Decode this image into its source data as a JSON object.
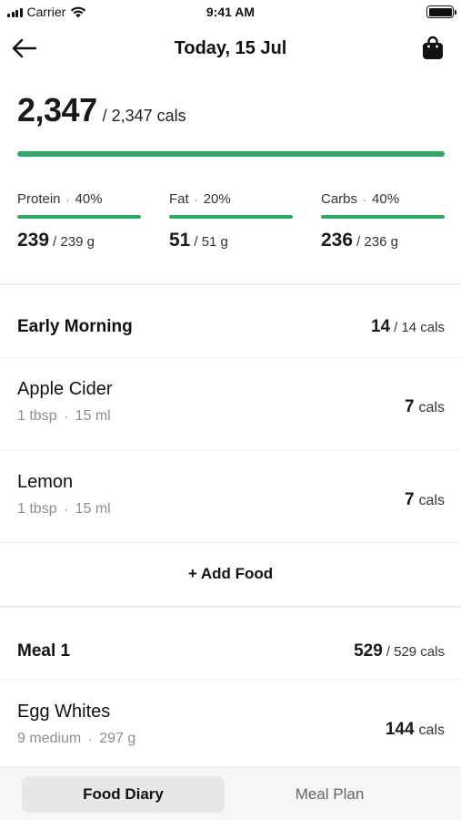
{
  "status_bar": {
    "carrier": "Carrier",
    "time": "9:41 AM"
  },
  "nav": {
    "title": "Today, 15 Jul",
    "back_icon": "arrow-left-icon",
    "right_icon": "shopping-bag-icon"
  },
  "summary": {
    "calories": "2,347",
    "calories_goal": "/ 2,347 cals",
    "progress_fraction": 1.0,
    "accent_color": "#2fa865"
  },
  "macros": [
    {
      "name": "Protein",
      "percent": "40%",
      "value": "239",
      "goal": "/ 239 g",
      "progress_fraction": 1.0
    },
    {
      "name": "Fat",
      "percent": "20%",
      "value": "51",
      "goal": "/ 51 g",
      "progress_fraction": 1.0
    },
    {
      "name": "Carbs",
      "percent": "40%",
      "value": "236",
      "goal": "/ 236 g",
      "progress_fraction": 1.0
    }
  ],
  "groups": [
    {
      "title": "Early Morning",
      "total": "14",
      "total_goal": "/ 14 cals",
      "items": [
        {
          "name": "Apple Cider",
          "amount": "1 tbsp",
          "weight": "15 ml",
          "cals": "7",
          "unit": "cals"
        },
        {
          "name": "Lemon",
          "amount": "1 tbsp",
          "weight": "15 ml",
          "cals": "7",
          "unit": "cals"
        }
      ],
      "add_label": "+ Add Food"
    },
    {
      "title": "Meal 1",
      "total": "529",
      "total_goal": "/ 529 cals",
      "items": [
        {
          "name": "Egg Whites",
          "amount": "9 medium",
          "weight": "297 g",
          "cals": "144",
          "unit": "cals"
        }
      ]
    }
  ],
  "separator_dot": "·",
  "tabs": [
    {
      "label": "Food Diary",
      "active": true
    },
    {
      "label": "Meal Plan",
      "active": false
    }
  ]
}
